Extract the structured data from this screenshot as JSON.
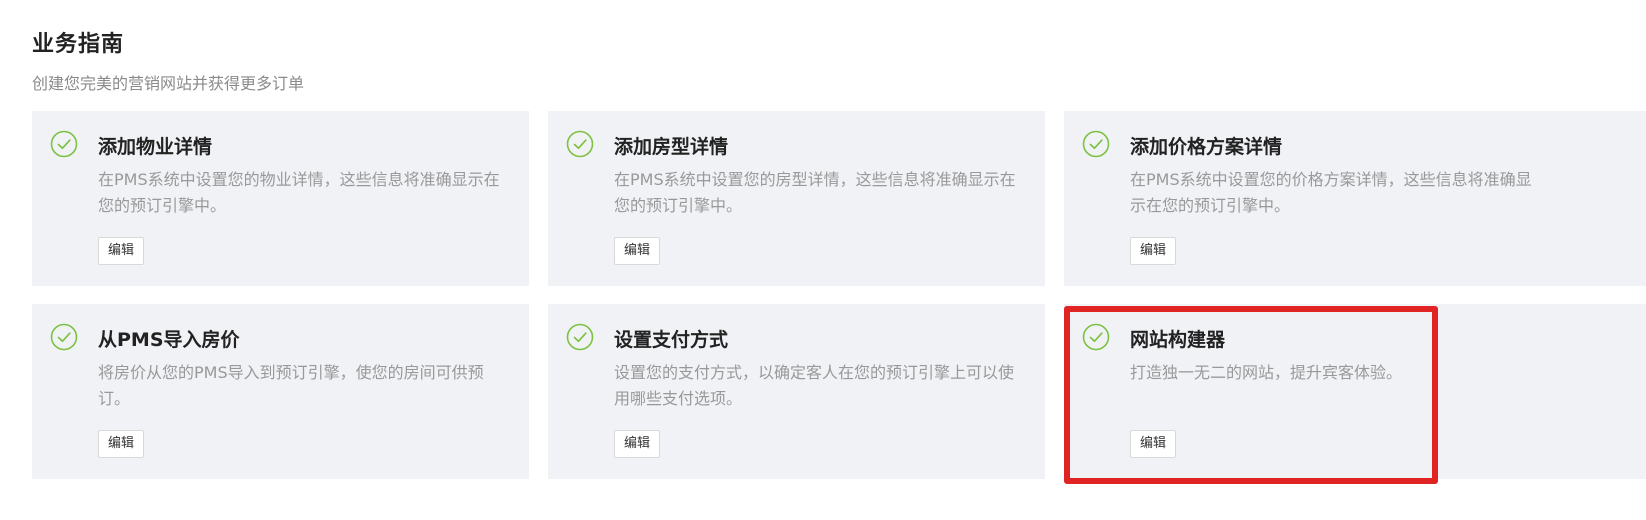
{
  "header": {
    "title": "业务指南",
    "subtitle": "创建您完美的营销网站并获得更多订单"
  },
  "cards": [
    {
      "title": "添加物业详情",
      "description": "在PMS系统中设置您的物业详情，这些信息将准确显示在您的预订引擎中。",
      "button": "编辑",
      "icon": "check-circle-icon",
      "completed": true
    },
    {
      "title": "添加房型详情",
      "description": "在PMS系统中设置您的房型详情，这些信息将准确显示在您的预订引擎中。",
      "button": "编辑",
      "icon": "check-circle-icon",
      "completed": true
    },
    {
      "title": "添加价格方案详情",
      "description": "在PMS系统中设置您的价格方案详情，这些信息将准确显示在您的预订引擎中。",
      "button": "编辑",
      "icon": "check-circle-icon",
      "completed": true
    },
    {
      "title": "从PMS导入房价",
      "description": "将房价从您的PMS导入到预订引擎，使您的房间可供预订。",
      "button": "编辑",
      "icon": "check-circle-icon",
      "completed": true
    },
    {
      "title": "设置支付方式",
      "description": "设置您的支付方式，以确定客人在您的预订引擎上可以使用哪些支付选项。",
      "button": "编辑",
      "icon": "check-circle-icon",
      "completed": true
    },
    {
      "title": "网站构建器",
      "description": "打造独一无二的网站，提升宾客体验。",
      "button": "编辑",
      "icon": "check-circle-icon",
      "completed": true
    }
  ],
  "colors": {
    "check": "#7cc241",
    "card_bg": "#f1f2f6",
    "highlight": "#e02424"
  }
}
